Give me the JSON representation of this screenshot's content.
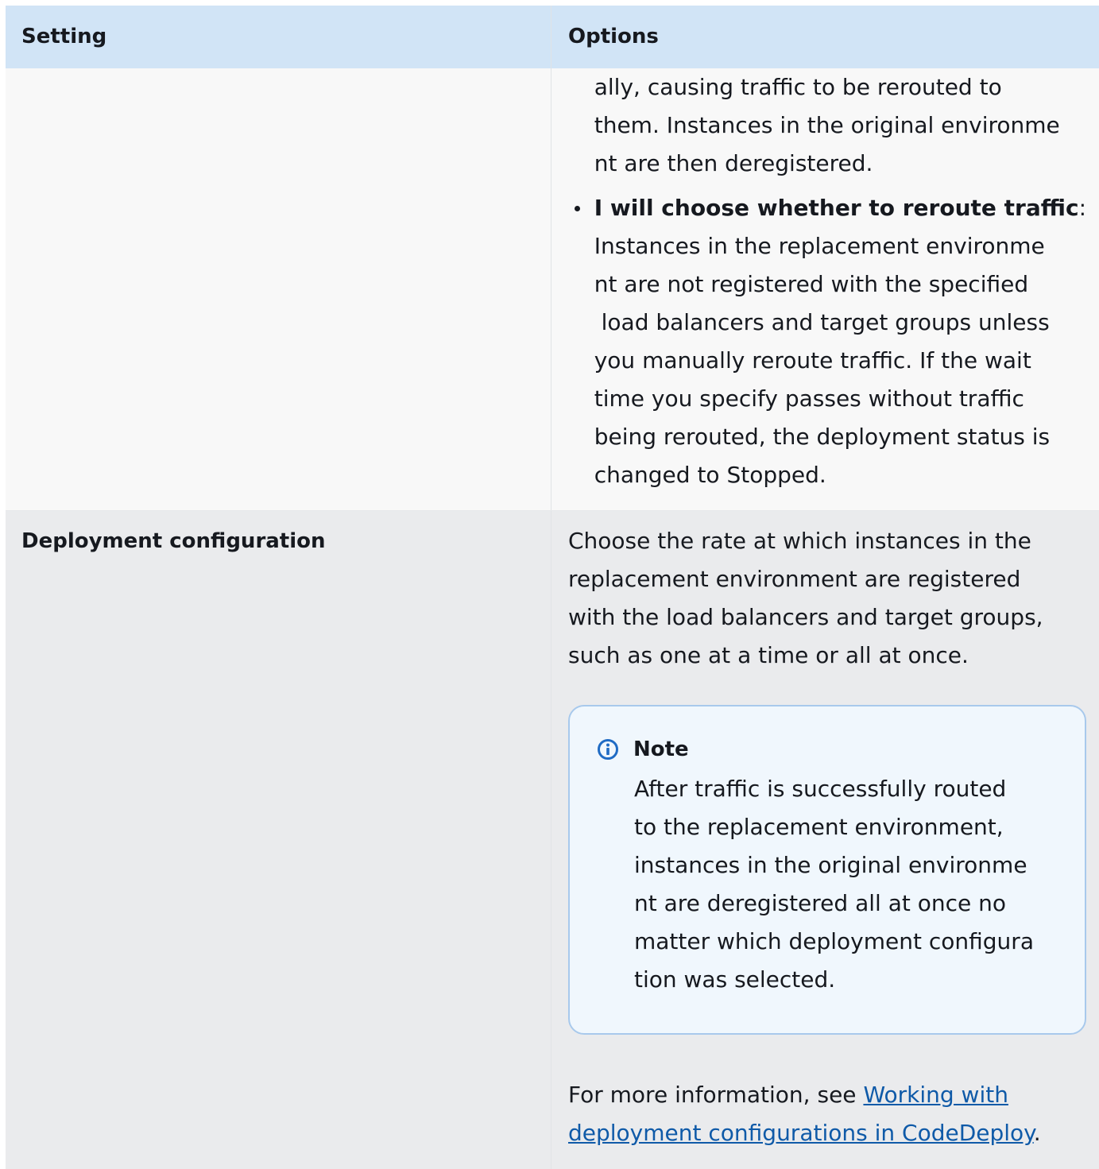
{
  "header": {
    "setting": "Setting",
    "options": "Options"
  },
  "row1": {
    "continuation_lines": [
      "ally, causing traffic to be rerouted to",
      "them. Instances in the original environme",
      "nt are then deregistered."
    ],
    "bullet": {
      "bold_label": "I will choose whether to reroute traffic",
      "colon": ":",
      "lines": [
        "Instances in the replacement environme",
        "nt are not registered with the specified",
        " load balancers and target groups unless",
        "you manually reroute traffic. If the wait",
        "time you specify passes without traffic",
        "being rerouted, the deployment status is",
        "changed to Stopped."
      ]
    }
  },
  "row2": {
    "setting": "Deployment configuration",
    "description_lines": [
      "Choose the rate at which instances in the",
      "replacement environment are registered",
      "with the load balancers and target groups,",
      "such as one at a time or all at once."
    ],
    "note": {
      "icon": "info-icon",
      "title": "Note",
      "lines": [
        "After traffic is successfully routed",
        "to the replacement environment,",
        "instances in the original environme",
        "nt are deregistered all at once no",
        "matter which deployment configura",
        "tion was selected."
      ]
    },
    "more_info": {
      "prefix": "For more information, see ",
      "link_line1": "Working with",
      "link_line2": "deployment configurations in CodeDeploy",
      "suffix": "."
    }
  },
  "colors": {
    "header_bg": "#d1e4f6",
    "row1_bg": "#f8f8f8",
    "row2_bg": "#eaebed",
    "note_border": "#a8c9ec",
    "note_bg": "#f0f7fd",
    "link": "#0f5aa8",
    "info_icon": "#1f6bc4"
  }
}
